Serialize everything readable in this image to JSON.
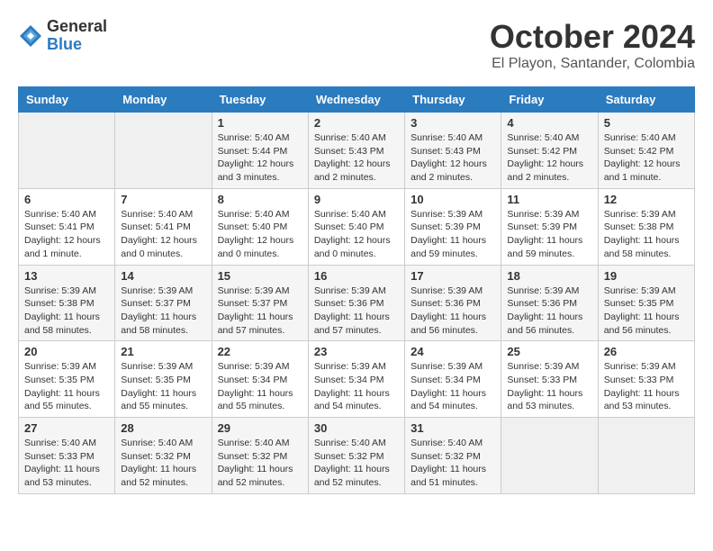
{
  "logo": {
    "general": "General",
    "blue": "Blue"
  },
  "title": "October 2024",
  "location": "El Playon, Santander, Colombia",
  "weekdays": [
    "Sunday",
    "Monday",
    "Tuesday",
    "Wednesday",
    "Thursday",
    "Friday",
    "Saturday"
  ],
  "weeks": [
    [
      {
        "day": "",
        "detail": ""
      },
      {
        "day": "",
        "detail": ""
      },
      {
        "day": "1",
        "detail": "Sunrise: 5:40 AM\nSunset: 5:44 PM\nDaylight: 12 hours\nand 3 minutes."
      },
      {
        "day": "2",
        "detail": "Sunrise: 5:40 AM\nSunset: 5:43 PM\nDaylight: 12 hours\nand 2 minutes."
      },
      {
        "day": "3",
        "detail": "Sunrise: 5:40 AM\nSunset: 5:43 PM\nDaylight: 12 hours\nand 2 minutes."
      },
      {
        "day": "4",
        "detail": "Sunrise: 5:40 AM\nSunset: 5:42 PM\nDaylight: 12 hours\nand 2 minutes."
      },
      {
        "day": "5",
        "detail": "Sunrise: 5:40 AM\nSunset: 5:42 PM\nDaylight: 12 hours\nand 1 minute."
      }
    ],
    [
      {
        "day": "6",
        "detail": "Sunrise: 5:40 AM\nSunset: 5:41 PM\nDaylight: 12 hours\nand 1 minute."
      },
      {
        "day": "7",
        "detail": "Sunrise: 5:40 AM\nSunset: 5:41 PM\nDaylight: 12 hours\nand 0 minutes."
      },
      {
        "day": "8",
        "detail": "Sunrise: 5:40 AM\nSunset: 5:40 PM\nDaylight: 12 hours\nand 0 minutes."
      },
      {
        "day": "9",
        "detail": "Sunrise: 5:40 AM\nSunset: 5:40 PM\nDaylight: 12 hours\nand 0 minutes."
      },
      {
        "day": "10",
        "detail": "Sunrise: 5:39 AM\nSunset: 5:39 PM\nDaylight: 11 hours\nand 59 minutes."
      },
      {
        "day": "11",
        "detail": "Sunrise: 5:39 AM\nSunset: 5:39 PM\nDaylight: 11 hours\nand 59 minutes."
      },
      {
        "day": "12",
        "detail": "Sunrise: 5:39 AM\nSunset: 5:38 PM\nDaylight: 11 hours\nand 58 minutes."
      }
    ],
    [
      {
        "day": "13",
        "detail": "Sunrise: 5:39 AM\nSunset: 5:38 PM\nDaylight: 11 hours\nand 58 minutes."
      },
      {
        "day": "14",
        "detail": "Sunrise: 5:39 AM\nSunset: 5:37 PM\nDaylight: 11 hours\nand 58 minutes."
      },
      {
        "day": "15",
        "detail": "Sunrise: 5:39 AM\nSunset: 5:37 PM\nDaylight: 11 hours\nand 57 minutes."
      },
      {
        "day": "16",
        "detail": "Sunrise: 5:39 AM\nSunset: 5:36 PM\nDaylight: 11 hours\nand 57 minutes."
      },
      {
        "day": "17",
        "detail": "Sunrise: 5:39 AM\nSunset: 5:36 PM\nDaylight: 11 hours\nand 56 minutes."
      },
      {
        "day": "18",
        "detail": "Sunrise: 5:39 AM\nSunset: 5:36 PM\nDaylight: 11 hours\nand 56 minutes."
      },
      {
        "day": "19",
        "detail": "Sunrise: 5:39 AM\nSunset: 5:35 PM\nDaylight: 11 hours\nand 56 minutes."
      }
    ],
    [
      {
        "day": "20",
        "detail": "Sunrise: 5:39 AM\nSunset: 5:35 PM\nDaylight: 11 hours\nand 55 minutes."
      },
      {
        "day": "21",
        "detail": "Sunrise: 5:39 AM\nSunset: 5:35 PM\nDaylight: 11 hours\nand 55 minutes."
      },
      {
        "day": "22",
        "detail": "Sunrise: 5:39 AM\nSunset: 5:34 PM\nDaylight: 11 hours\nand 55 minutes."
      },
      {
        "day": "23",
        "detail": "Sunrise: 5:39 AM\nSunset: 5:34 PM\nDaylight: 11 hours\nand 54 minutes."
      },
      {
        "day": "24",
        "detail": "Sunrise: 5:39 AM\nSunset: 5:34 PM\nDaylight: 11 hours\nand 54 minutes."
      },
      {
        "day": "25",
        "detail": "Sunrise: 5:39 AM\nSunset: 5:33 PM\nDaylight: 11 hours\nand 53 minutes."
      },
      {
        "day": "26",
        "detail": "Sunrise: 5:39 AM\nSunset: 5:33 PM\nDaylight: 11 hours\nand 53 minutes."
      }
    ],
    [
      {
        "day": "27",
        "detail": "Sunrise: 5:40 AM\nSunset: 5:33 PM\nDaylight: 11 hours\nand 53 minutes."
      },
      {
        "day": "28",
        "detail": "Sunrise: 5:40 AM\nSunset: 5:32 PM\nDaylight: 11 hours\nand 52 minutes."
      },
      {
        "day": "29",
        "detail": "Sunrise: 5:40 AM\nSunset: 5:32 PM\nDaylight: 11 hours\nand 52 minutes."
      },
      {
        "day": "30",
        "detail": "Sunrise: 5:40 AM\nSunset: 5:32 PM\nDaylight: 11 hours\nand 52 minutes."
      },
      {
        "day": "31",
        "detail": "Sunrise: 5:40 AM\nSunset: 5:32 PM\nDaylight: 11 hours\nand 51 minutes."
      },
      {
        "day": "",
        "detail": ""
      },
      {
        "day": "",
        "detail": ""
      }
    ]
  ]
}
